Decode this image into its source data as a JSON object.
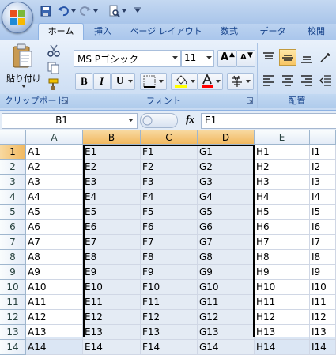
{
  "ribbon": {
    "tabs": [
      {
        "id": "home",
        "label": "ホーム"
      },
      {
        "id": "insert",
        "label": "挿入"
      },
      {
        "id": "layout",
        "label": "ページ レイアウト"
      },
      {
        "id": "formulas",
        "label": "数式"
      },
      {
        "id": "data",
        "label": "データ"
      },
      {
        "id": "review",
        "label": "校閲"
      }
    ],
    "clipboard": {
      "paste_label": "貼り付け",
      "group_label": "クリップボード"
    },
    "font": {
      "font_name": "MS Pゴシック",
      "font_size": "11",
      "group_label": "フォント",
      "bold": "B",
      "italic": "I",
      "underline": "U",
      "grow": "A",
      "shrink": "A"
    },
    "alignment": {
      "group_label": "配置"
    }
  },
  "formula_bar": {
    "name_box": "B1",
    "fx": "fx",
    "formula": "E1"
  },
  "grid": {
    "columns": [
      "A",
      "B",
      "C",
      "D",
      "E"
    ],
    "extra_column_cells": [
      "I1",
      "I2",
      "I3",
      "I4",
      "I5",
      "I6",
      "I7",
      "I8",
      "I9",
      "I10",
      "I11",
      "I12",
      "I13",
      "I14"
    ],
    "rows": [
      {
        "num": "1",
        "cells": [
          "A1",
          "E1",
          "F1",
          "G1",
          "H1"
        ]
      },
      {
        "num": "2",
        "cells": [
          "A2",
          "E2",
          "F2",
          "G2",
          "H2"
        ]
      },
      {
        "num": "3",
        "cells": [
          "A3",
          "E3",
          "F3",
          "G3",
          "H3"
        ]
      },
      {
        "num": "4",
        "cells": [
          "A4",
          "E4",
          "F4",
          "G4",
          "H4"
        ]
      },
      {
        "num": "5",
        "cells": [
          "A5",
          "E5",
          "F5",
          "G5",
          "H5"
        ]
      },
      {
        "num": "6",
        "cells": [
          "A6",
          "E6",
          "F6",
          "G6",
          "H6"
        ]
      },
      {
        "num": "7",
        "cells": [
          "A7",
          "E7",
          "F7",
          "G7",
          "H7"
        ]
      },
      {
        "num": "8",
        "cells": [
          "A8",
          "E8",
          "F8",
          "G8",
          "H8"
        ]
      },
      {
        "num": "9",
        "cells": [
          "A9",
          "E9",
          "F9",
          "G9",
          "H9"
        ]
      },
      {
        "num": "10",
        "cells": [
          "A10",
          "E10",
          "F10",
          "G10",
          "H10"
        ]
      },
      {
        "num": "11",
        "cells": [
          "A11",
          "E11",
          "F11",
          "G11",
          "H11"
        ]
      },
      {
        "num": "12",
        "cells": [
          "A12",
          "E12",
          "F12",
          "G12",
          "H12"
        ]
      },
      {
        "num": "13",
        "cells": [
          "A13",
          "E13",
          "F13",
          "G13",
          "H13"
        ]
      },
      {
        "num": "14",
        "cells": [
          "A14",
          "E14",
          "F14",
          "G14",
          "H14"
        ]
      }
    ]
  },
  "colors": {
    "selection_header": "#f1b85f",
    "selection_fill": "#e4ebf4",
    "ribbon_text": "#15428b"
  }
}
